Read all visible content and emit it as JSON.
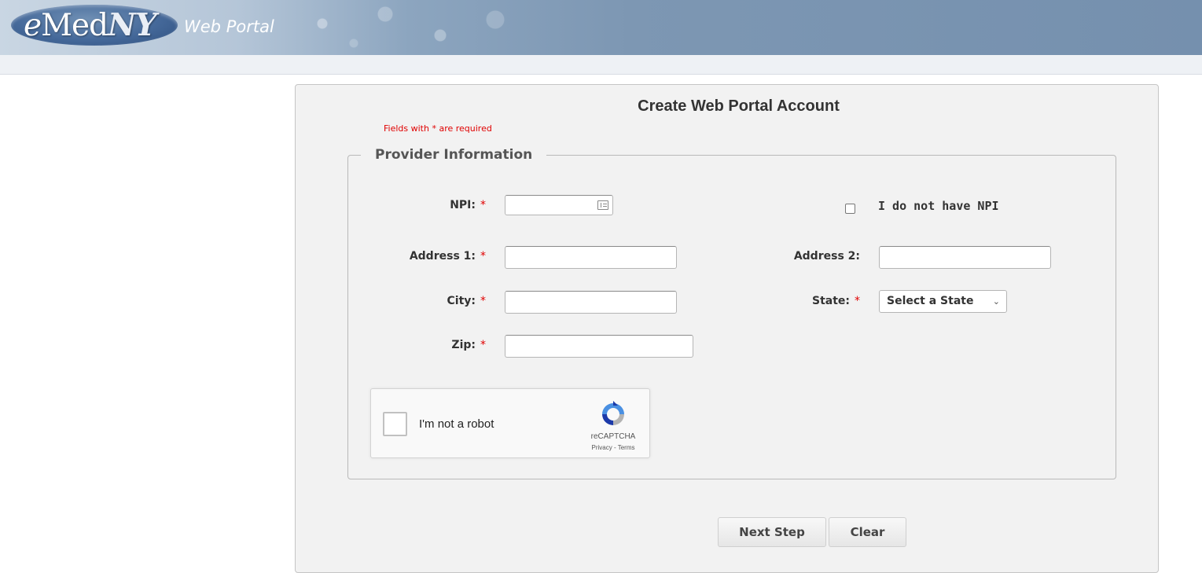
{
  "header": {
    "logo_e": "e",
    "logo_med": "Med",
    "logo_ny": "NY",
    "subtitle": "Web Portal"
  },
  "form": {
    "title": "Create Web Portal Account",
    "required_note": "Fields with * are required",
    "section_legend": "Provider Information",
    "required_marker": "*",
    "npi_label": "NPI:",
    "npi_value": "",
    "no_npi_label": "I do not have NPI",
    "no_npi_checked": false,
    "address1_label": "Address 1:",
    "address1_value": "",
    "address2_label": "Address 2:",
    "address2_value": "",
    "city_label": "City:",
    "city_value": "",
    "state_label": "State:",
    "state_selected": "Select a State",
    "zip_label": "Zip:",
    "zip_value": ""
  },
  "captcha": {
    "label": "I'm not a robot",
    "brand": "reCAPTCHA",
    "links": "Privacy - Terms",
    "checked": false
  },
  "buttons": {
    "next_label": "Next Step",
    "clear_label": "Clear"
  },
  "colors": {
    "required_red": "#e00000",
    "banner_blue": "#7590ae",
    "panel_bg": "#f2f2f2"
  }
}
